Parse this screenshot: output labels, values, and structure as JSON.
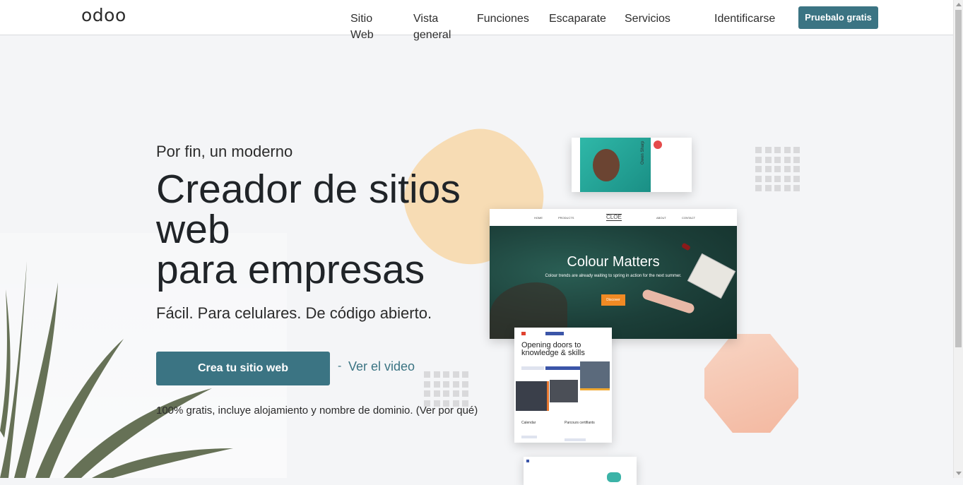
{
  "nav": {
    "logo": "odoo",
    "links": [
      "Sitio Web",
      "Vista general",
      "Funciones",
      "Escaparate",
      "Servicios"
    ],
    "login": "Identificarse",
    "cta": "Pruebalo gratis"
  },
  "hero": {
    "pretitle": "Por fin, un moderno",
    "headline_lines": [
      "Creador de sitios",
      "web",
      "para empresas"
    ],
    "subtitle": "Fácil. Para celulares. De código abierto.",
    "cta": "Crea tu sitio web",
    "separator": "-",
    "video_link": "Ver el video",
    "note": "100% gratis, incluye alojamiento y nombre de dominio. (Ver por qué)"
  },
  "showcase": {
    "cloe": {
      "brand": "CLOE",
      "nav_items": [
        "HOME",
        "PRODUCTS",
        "ABOUT",
        "CONTACT"
      ],
      "title": "Colour Matters",
      "subtitle": "Colour trends are already waiting to spring in action for the next summer.",
      "button": "Discover"
    },
    "school": {
      "title": "Opening doors to knowledge & skills",
      "col1": "Calendar",
      "col2": "Parcours certifiants"
    },
    "profile": {
      "name": "Owen Sharp"
    }
  },
  "colors": {
    "accent": "#3b7483",
    "blob": "#f7dcb4",
    "octagon": "#f3b8a0"
  }
}
